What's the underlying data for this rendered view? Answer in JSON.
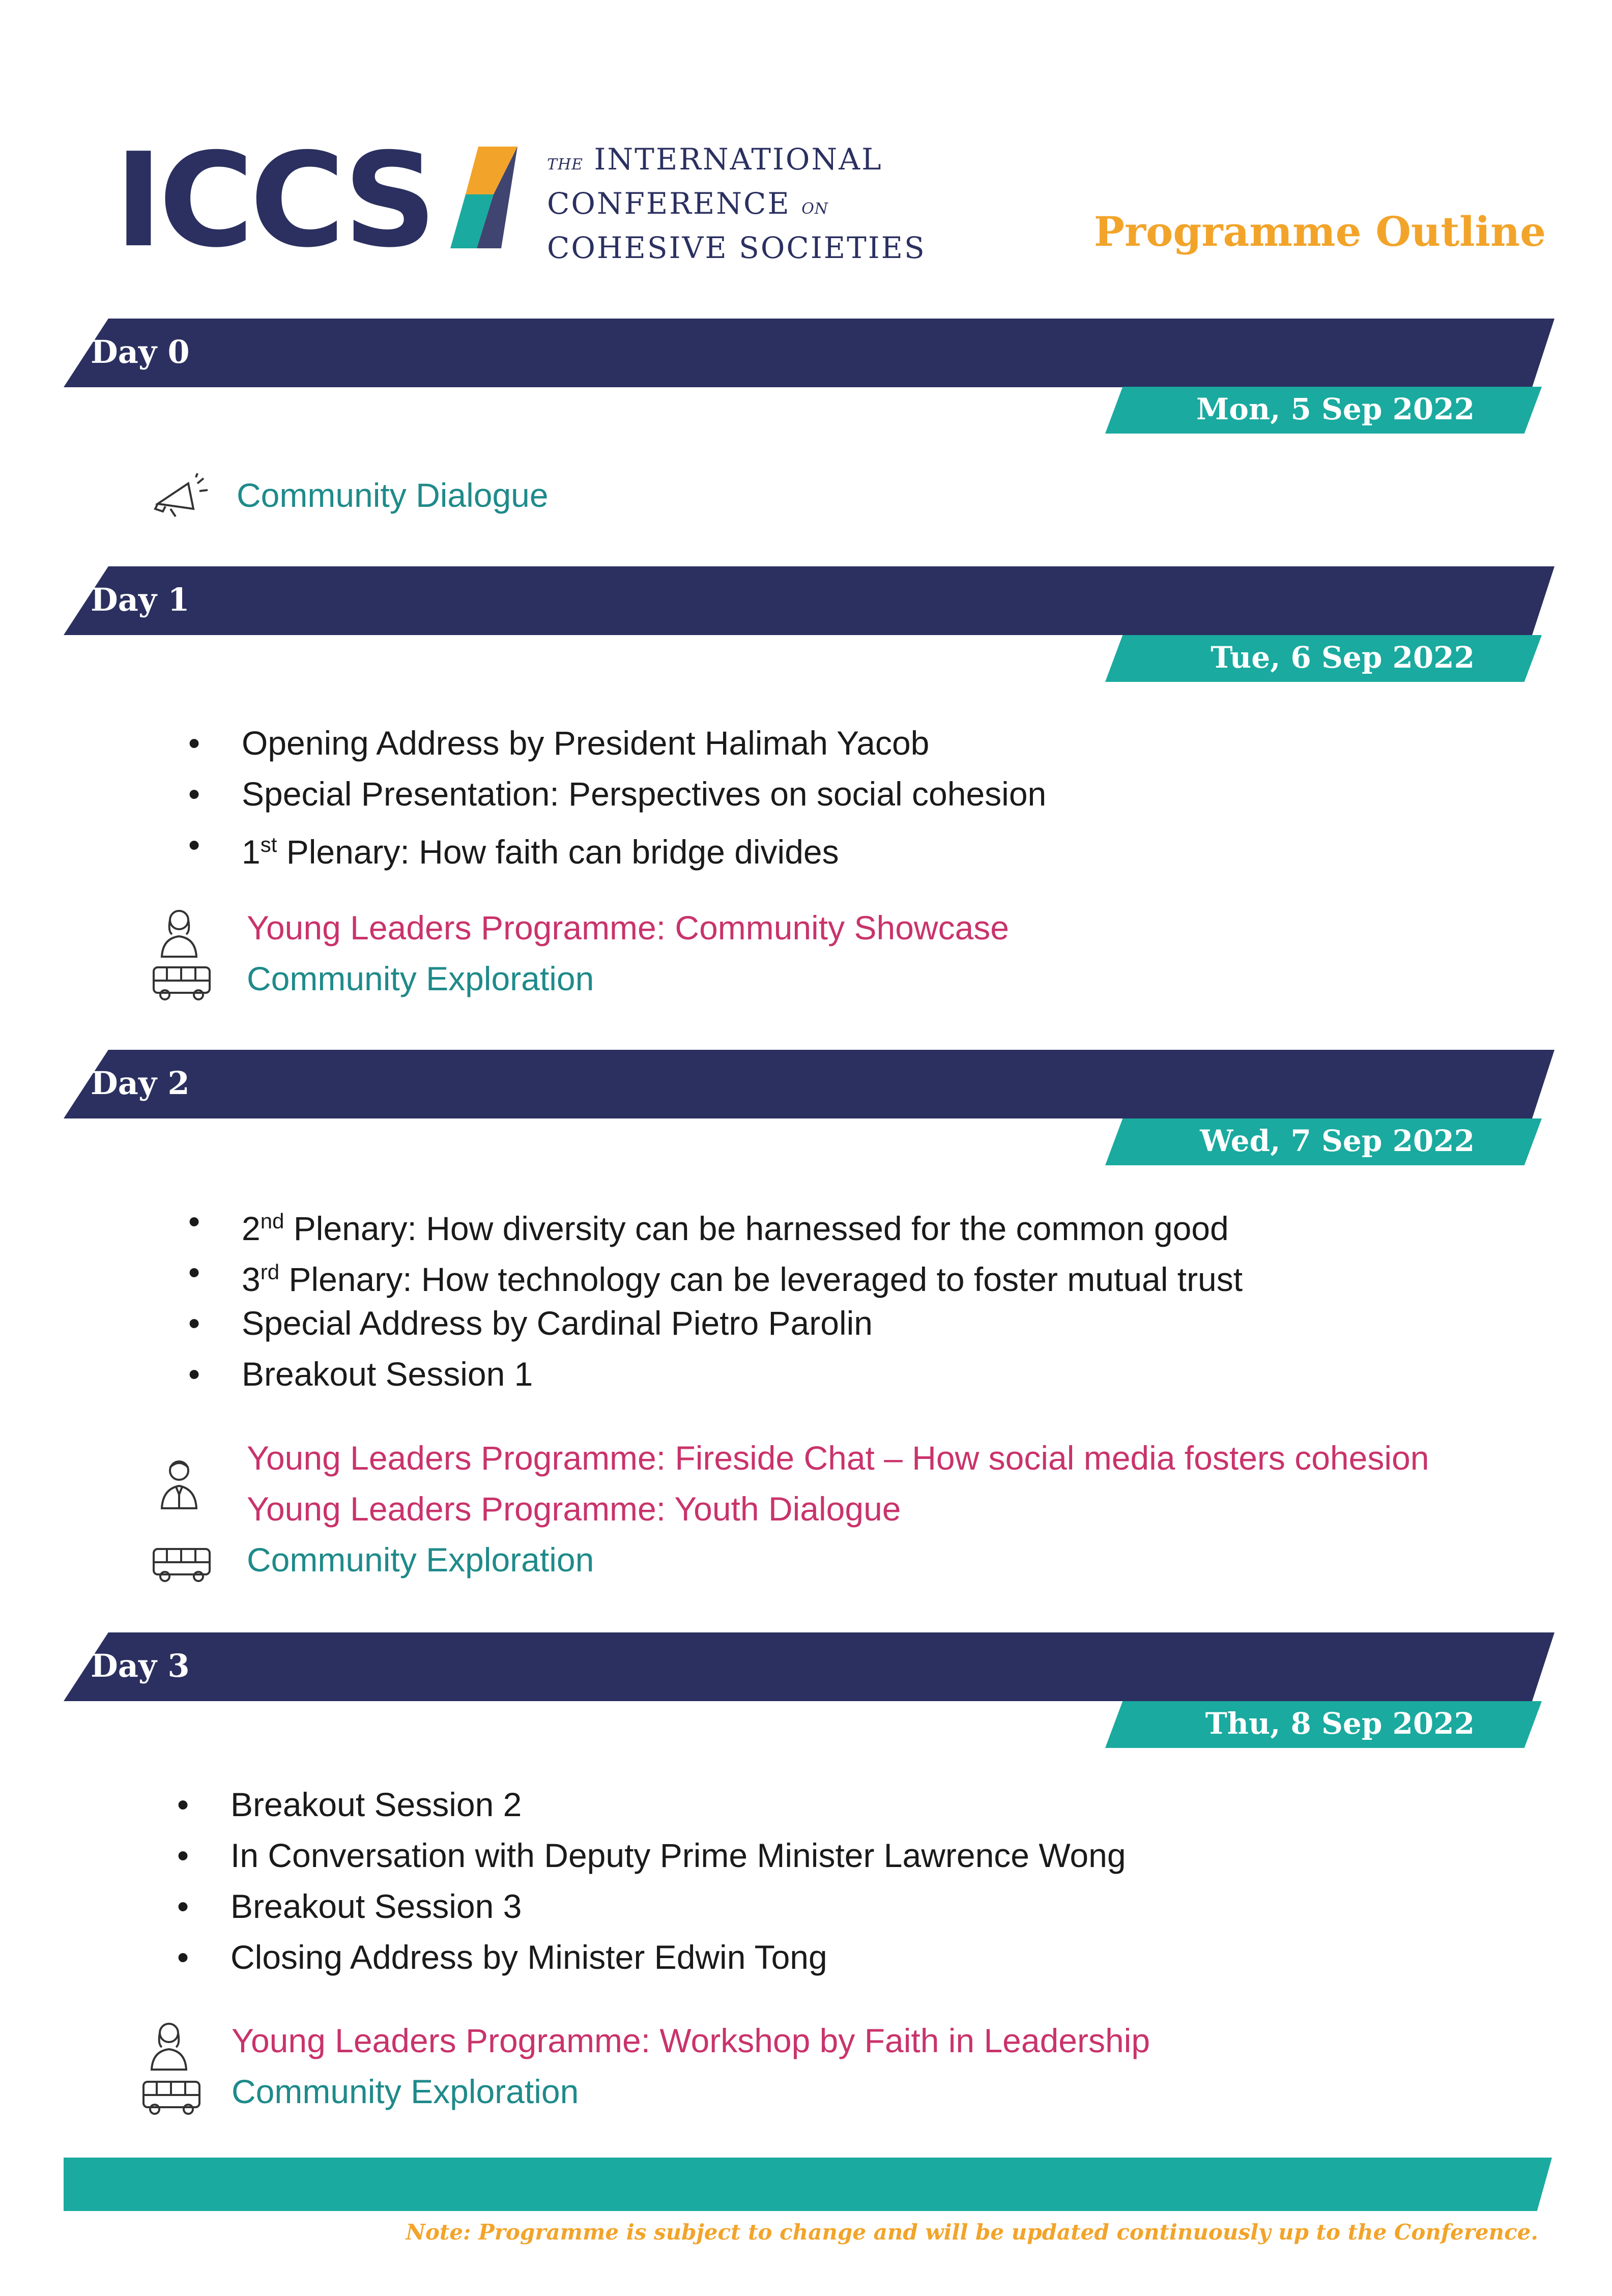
{
  "brand": {
    "logo_text": "ICCS",
    "name_line1_small": "THE",
    "name_line1": "INTERNATIONAL",
    "name_line2": "CONFERENCE",
    "name_line2_small": "ON",
    "name_line3": "COHESIVE SOCIETIES",
    "colors": {
      "navy": "#2b3060",
      "teal": "#1aaa9f",
      "orange": "#f2a42a",
      "pink": "#c9336b"
    }
  },
  "title": "Programme Outline",
  "days": [
    {
      "label": "Day 0",
      "date": "Mon, 5 Sep 2022",
      "extras": [
        {
          "icon": "megaphone-icon",
          "text": "Community Dialogue"
        }
      ]
    },
    {
      "label": "Day 1",
      "date": "Tue, 6 Sep 2022",
      "bullets": [
        {
          "text": "Opening Address by President Halimah Yacob"
        },
        {
          "text": "Special Presentation: Perspectives on social cohesion"
        },
        {
          "pre": "1",
          "sup": "st",
          "text": " Plenary: How faith can bridge divides"
        }
      ],
      "extras": [
        {
          "icon": "female-person-icon",
          "text": "Young Leaders Programme: Community Showcase"
        },
        {
          "icon": "bus-icon",
          "text": "Community Exploration"
        }
      ]
    },
    {
      "label": "Day 2",
      "date": "Wed, 7 Sep 2022",
      "bullets": [
        {
          "pre": "2",
          "sup": "nd",
          "text": " Plenary: How diversity can be harnessed for the common good"
        },
        {
          "pre": "3",
          "sup": "rd",
          "text": " Plenary: How technology can be leveraged to foster mutual trust"
        },
        {
          "text": "Special Address by Cardinal Pietro Parolin"
        },
        {
          "text": "Breakout Session 1"
        }
      ],
      "extras": [
        {
          "icon": "male-person-icon",
          "text": "Young Leaders Programme: Fireside Chat – How social media fosters cohesion"
        },
        {
          "text": "Young Leaders Programme: Youth Dialogue"
        },
        {
          "icon": "bus-icon",
          "text": "Community Exploration"
        }
      ]
    },
    {
      "label": "Day 3",
      "date": "Thu, 8 Sep 2022",
      "bullets": [
        {
          "text": "Breakout Session 2"
        },
        {
          "text": "In Conversation with Deputy Prime Minister Lawrence Wong"
        },
        {
          "text": "Breakout Session 3"
        },
        {
          "text": "Closing Address by Minister Edwin Tong"
        }
      ],
      "extras": [
        {
          "icon": "female-person-icon",
          "text": "Young Leaders Programme: Workshop by Faith in Leadership"
        },
        {
          "icon": "bus-icon",
          "text": "Community Exploration"
        }
      ]
    }
  ],
  "note": "Note: Programme is subject to change and will be updated continuously up to the Conference."
}
